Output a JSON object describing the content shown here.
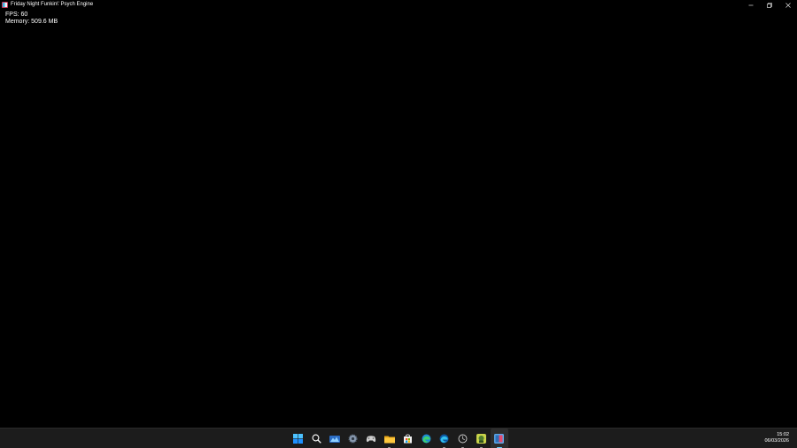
{
  "window": {
    "title": "Friday Night Funkin\\' Psych Engine",
    "icon": "fnf-app-icon"
  },
  "window_controls": {
    "minimize_icon": "minimize-icon",
    "maximize_icon": "restore-icon",
    "close_icon": "close-icon"
  },
  "overlay": {
    "fps": "FPS: 60",
    "memory": "Memory: 509.6 MB"
  },
  "taskbar": {
    "apps": [
      {
        "name": "start",
        "icon": "windows-start-icon",
        "running": false
      },
      {
        "name": "search",
        "icon": "search-icon",
        "running": false
      },
      {
        "name": "widgets",
        "icon": "widgets-icon",
        "running": false
      },
      {
        "name": "settings",
        "icon": "gear-icon",
        "running": false
      },
      {
        "name": "game-controller",
        "icon": "controller-icon",
        "running": false
      },
      {
        "name": "file-explorer",
        "icon": "folder-icon",
        "running": true
      },
      {
        "name": "store",
        "icon": "store-icon",
        "running": false
      },
      {
        "name": "edge-dev",
        "icon": "edge-dev-icon",
        "running": false
      },
      {
        "name": "edge",
        "icon": "edge-icon",
        "running": true
      },
      {
        "name": "clock-app",
        "icon": "clock-app-icon",
        "running": true
      },
      {
        "name": "app-green",
        "icon": "green-app-icon",
        "running": true
      },
      {
        "name": "fnf-game",
        "icon": "fnf-app-icon",
        "running": true,
        "active": true
      }
    ]
  },
  "clock": {
    "time": "15:02",
    "date": "06/03/2026"
  },
  "colors": {
    "background": "#000000",
    "taskbar": "#1c1c1c",
    "accent": "#60cdff",
    "text": "#ffffff"
  }
}
